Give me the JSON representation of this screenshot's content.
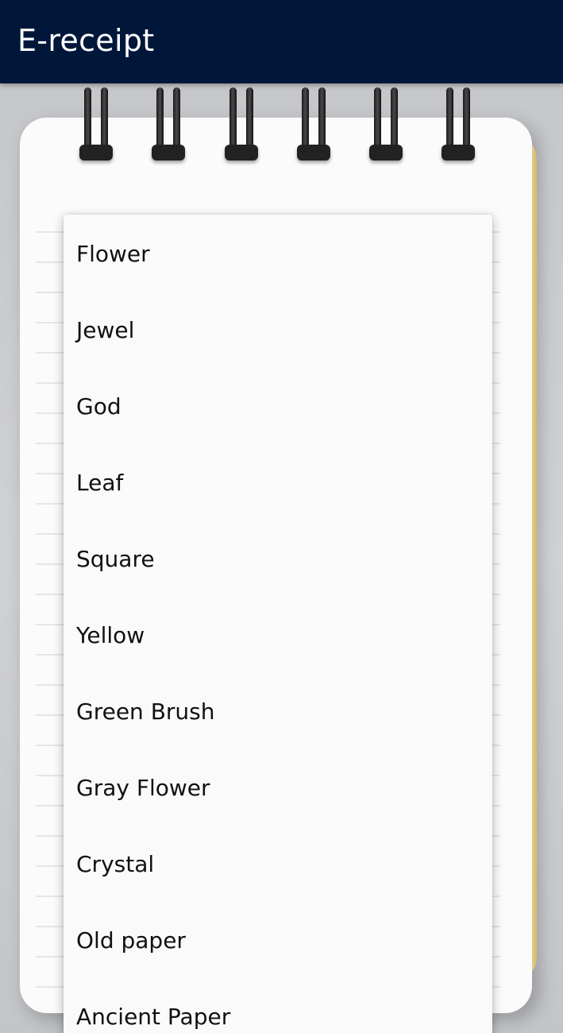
{
  "app_bar": {
    "title": "E-receipt",
    "background_color": "#00173a",
    "title_color": "#ffffff"
  },
  "dropdown": {
    "options": [
      "Flower",
      "Jewel",
      "God",
      "Leaf",
      "Square",
      "Yellow",
      "Green Brush",
      "Gray Flower",
      "Crystal",
      "Old paper",
      "Ancient Paper"
    ]
  }
}
